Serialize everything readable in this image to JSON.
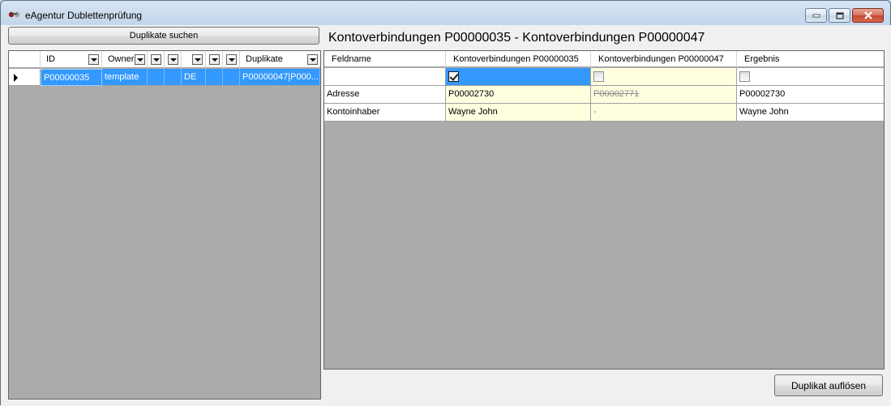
{
  "window": {
    "title": "eAgentur Dublettenprüfung"
  },
  "toolbar": {
    "search_label": "Duplikate suchen",
    "resolve_label": "Duplikat auflösen"
  },
  "comparison": {
    "heading": "Kontoverbindungen P00000035 - Kontoverbindungen P00000047"
  },
  "left_grid": {
    "columns": [
      {
        "label": "ID",
        "has_filter": true
      },
      {
        "label": "Owner",
        "has_filter": true
      },
      {
        "label": "",
        "has_filter": true
      },
      {
        "label": "",
        "has_filter": true
      },
      {
        "label": "",
        "has_filter": true
      },
      {
        "label": "",
        "has_filter": true
      },
      {
        "label": "",
        "has_filter": true
      },
      {
        "label": "Duplikate",
        "has_filter": true
      }
    ],
    "rows": [
      {
        "selected": true,
        "cells": [
          "P00000035",
          "template",
          "",
          "",
          "DE",
          "",
          "",
          "P00000047|P000..."
        ]
      }
    ]
  },
  "right_grid": {
    "columns": [
      "Feldname",
      "Kontoverbindungen P00000035",
      "Kontoverbindungen P00000047",
      "Ergebnis"
    ],
    "checkbox_row": {
      "col1_checked": true,
      "col2_checked": false,
      "col3_checked": false
    },
    "rows": [
      {
        "field": "Adresse",
        "left": "P00002730",
        "right": "P00002771",
        "result": "P00002730"
      },
      {
        "field": "Kontoinhaber",
        "left": "Wayne John",
        "right": "-",
        "result": "Wayne John"
      }
    ]
  },
  "colors": {
    "selection": "#3399ff",
    "highlight_cell": "#ffffe0",
    "grid_background": "#ababab"
  }
}
